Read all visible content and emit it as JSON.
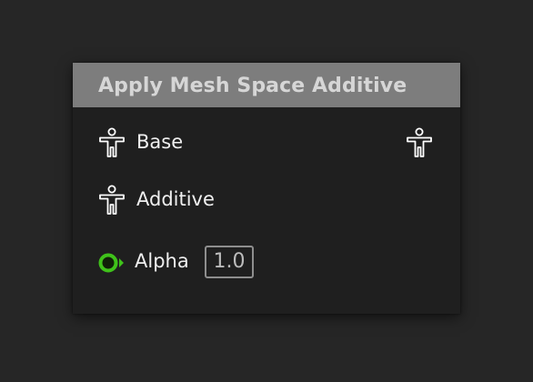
{
  "node": {
    "title": "Apply Mesh Space Additive",
    "pins": {
      "base": {
        "label": "Base",
        "icon": "pose-pin-icon",
        "has_output": true
      },
      "additive": {
        "label": "Additive",
        "icon": "pose-pin-icon"
      },
      "alpha": {
        "label": "Alpha",
        "value": "1.0",
        "icon": "float-pin-icon",
        "pin_color": "#3fc21a"
      }
    }
  },
  "colors": {
    "canvas_background": "#262626",
    "node_body": "#1f1f1f",
    "node_header": "#7d7d7d",
    "title_text": "#d6d6d6",
    "label_text": "#f0f0f0",
    "float_pin": "#3fc21a"
  }
}
